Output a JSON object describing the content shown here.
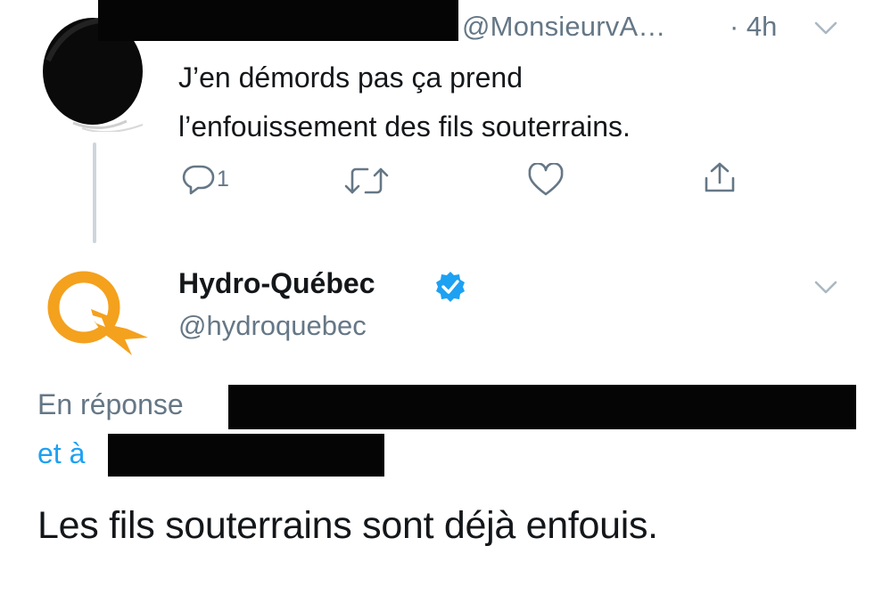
{
  "reply_tweet": {
    "handle": "@MonsieurvA…",
    "time": "· 4h",
    "text_line1": "J’en démords pas ça prend",
    "text_line2": "l’enfouissement des fils souterrains.",
    "reply_count": "1"
  },
  "main_tweet": {
    "author_name": "Hydro-Québec",
    "handle": "@hydroquebec",
    "in_reply_prefix": "En réponse",
    "and_prefix": "et à",
    "text": "Les fils souterrains sont déjà enfouis."
  },
  "colors": {
    "brand_orange": "#f4a11d",
    "verified_blue": "#1da1f2",
    "link_blue": "#1da1f2",
    "secondary_gray": "#657786",
    "redaction": "#050505"
  },
  "icons": [
    "reply-icon",
    "retweet-icon",
    "like-icon",
    "share-icon",
    "chevron-down-icon",
    "verified-badge-icon"
  ]
}
